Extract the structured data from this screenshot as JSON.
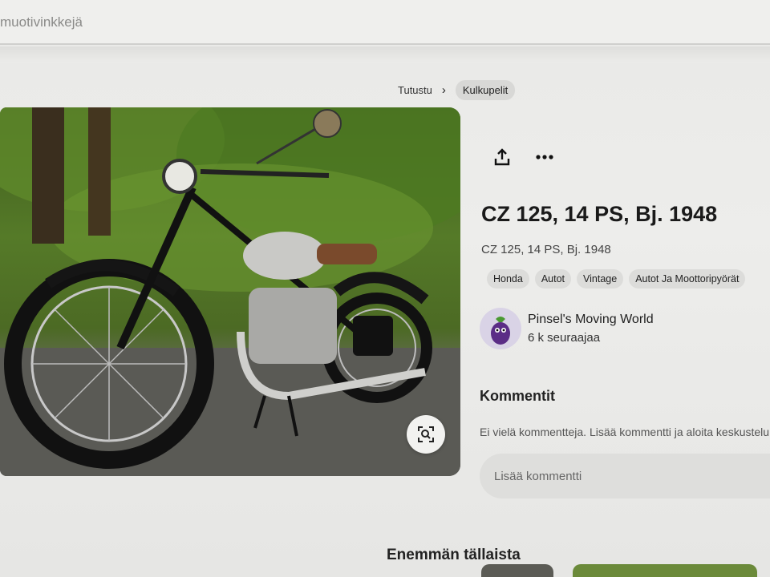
{
  "topbar": {
    "text": "muotivinkkejä"
  },
  "breadcrumb": {
    "items": [
      "Tutustu",
      "Kulkupelit"
    ]
  },
  "pin": {
    "title": "CZ 125, 14 PS, Bj. 1948",
    "description": "CZ 125, 14 PS, Bj. 1948",
    "tags": [
      "Honda",
      "Autot",
      "Vintage",
      "Autot Ja Moottoripyörät"
    ]
  },
  "actions": {
    "share_icon": "share-icon",
    "more_icon": "more-icon",
    "lens_icon": "visual-search-icon"
  },
  "creator": {
    "name": "Pinsel's Moving World",
    "followers": "6 k seuraajaa"
  },
  "comments": {
    "title": "Kommentit",
    "empty_text": "Ei vielä kommentteja. Lisää kommentti ja aloita keskustelu!",
    "placeholder": "Lisää kommentti"
  },
  "more": {
    "title": "Enemmän tällaista"
  },
  "colors": {
    "page_bg": "#ececea",
    "pill_bg": "#dcdcda",
    "text": "#1d1d1d"
  }
}
